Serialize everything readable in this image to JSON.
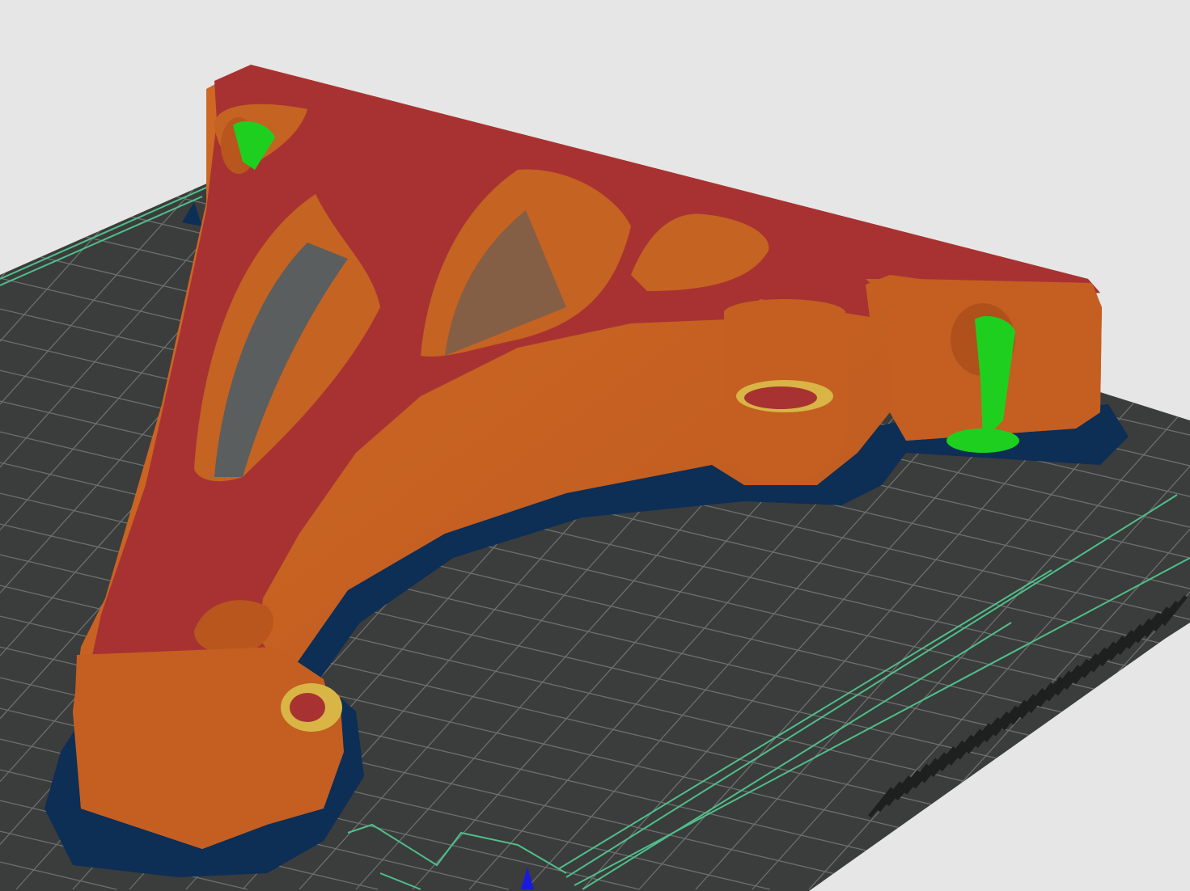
{
  "viewport": {
    "view": "3d-slice-preview",
    "colors": {
      "background": "#e6e6e6",
      "bed": "#3b3c3c",
      "bed_grid": "#6d6f6f",
      "bed_edge_lines": "#4fbf8a",
      "perimeter": "#c75f22",
      "top_solid_infill": "#a83232",
      "brim_skirt": "#0d2e55",
      "support": "#1fcf1f",
      "overhang_yellow": "#d8b545",
      "axis_z": "#1a1adf"
    }
  }
}
